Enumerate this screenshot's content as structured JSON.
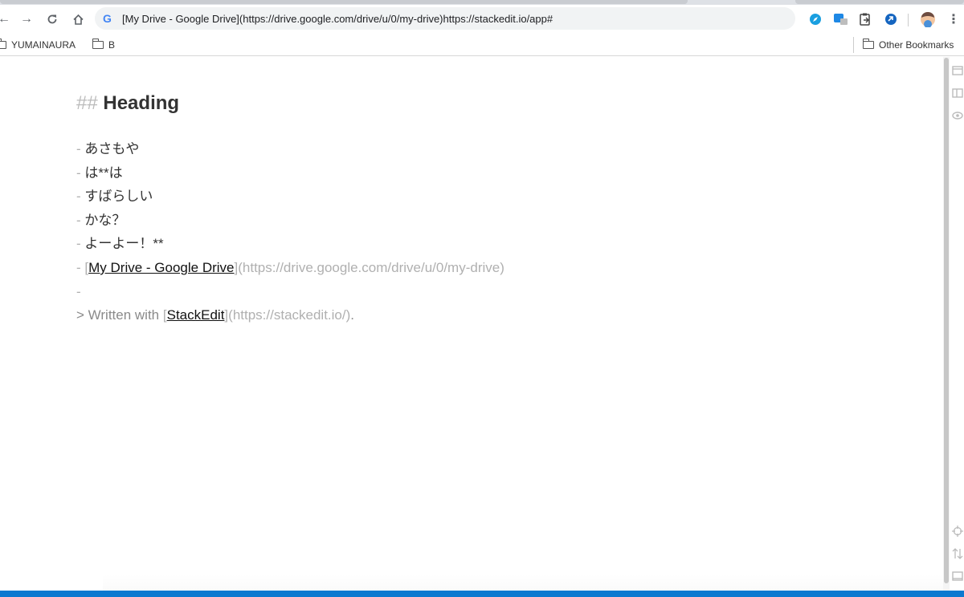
{
  "browser": {
    "omnibox_text": "[My Drive - Google Drive](https://drive.google.com/drive/u/0/my-drive)https://stackedit.io/app#",
    "bookmarks": [
      "YUMAINAURA",
      "B"
    ],
    "other_bookmarks": "Other Bookmarks"
  },
  "editor": {
    "heading_marker": "##",
    "heading_text": "Heading",
    "list_marker": "-",
    "items": [
      "あさもや",
      "は**は",
      "すばらしい",
      "かな？",
      "よーよー！**"
    ],
    "link_item": {
      "open": "[",
      "text": "My Drive - Google Drive",
      "close": "]",
      "url": "(https://drive.google.com/drive/u/0/my-drive)"
    },
    "quote": {
      "prefix": "> Written with ",
      "open": "[",
      "link_text": "StackEdit",
      "close": "]",
      "url": "(https://stackedit.io/)",
      "suffix": "."
    }
  },
  "colors": {
    "status_bar": "#0b79d0",
    "markdown_syntax": "#b0b0b0"
  }
}
